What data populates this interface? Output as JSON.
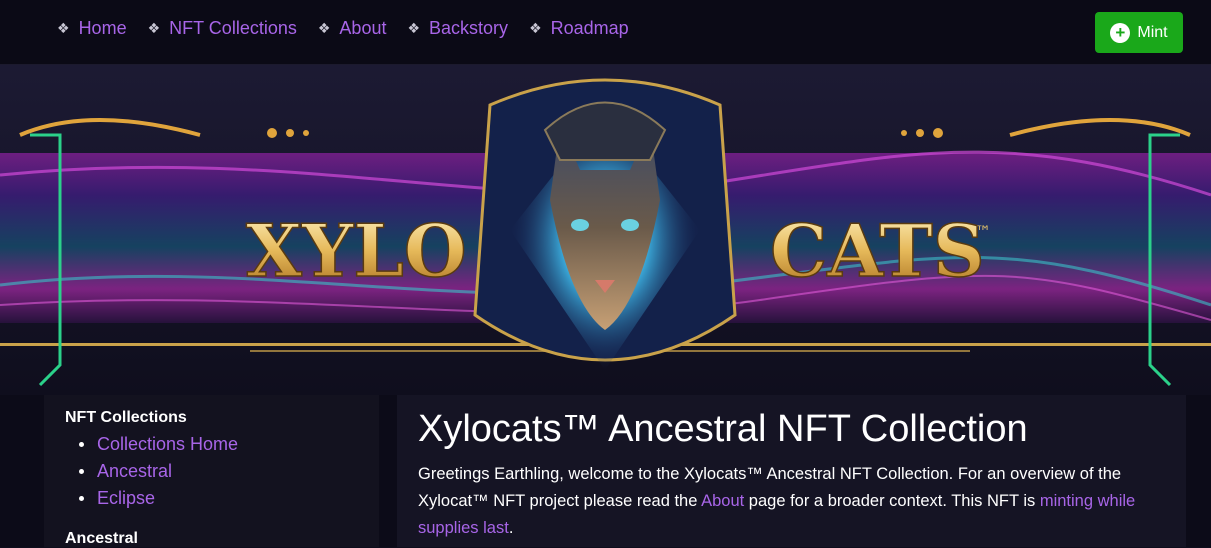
{
  "nav": {
    "items": [
      {
        "label": "Home"
      },
      {
        "label": "NFT Collections"
      },
      {
        "label": "About"
      },
      {
        "label": "Backstory"
      },
      {
        "label": "Roadmap"
      }
    ],
    "separator_glyph": "❖",
    "mint_label": "Mint"
  },
  "banner": {
    "logo_left": "XYLO",
    "logo_right": "CATS",
    "trademark": "™"
  },
  "sidebar": {
    "title": "NFT Collections",
    "items": [
      {
        "label": "Collections Home"
      },
      {
        "label": "Ancestral"
      },
      {
        "label": "Eclipse"
      }
    ],
    "section2_title": "Ancestral"
  },
  "main": {
    "title": "Xylocats™ Ancestral NFT Collection",
    "intro_text_1": "Greetings Earthling, welcome to the Xylocats™ Ancestral NFT Collection. For an overview of the Xylocat™ NFT project please read the ",
    "intro_link_1": "About",
    "intro_text_2": " page for a broader context. This NFT is ",
    "intro_link_2": "minting while supplies last",
    "intro_text_3": "."
  },
  "colors": {
    "link": "#a865e8",
    "mint_button": "#1aa81a",
    "background": "#0e0d1c"
  },
  "icons": {
    "nav_separator": "diamond-bullet-icon",
    "mint": "plus-circle-icon"
  }
}
